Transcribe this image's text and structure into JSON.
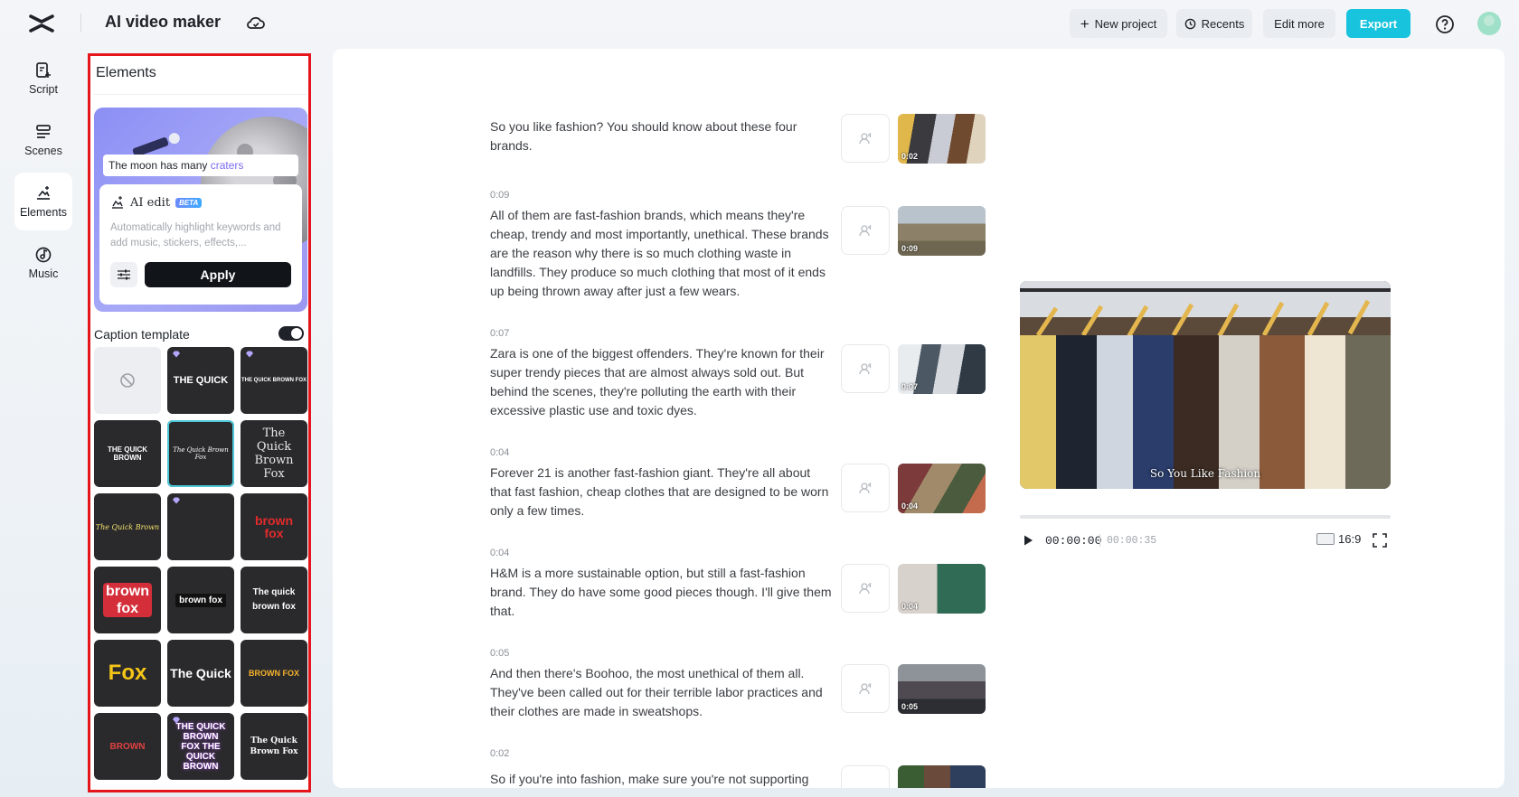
{
  "app": {
    "title": "AI video maker"
  },
  "toolbar": {
    "new_project": "New project",
    "recents": "Recents",
    "edit_more": "Edit more",
    "export": "Export"
  },
  "nav": [
    {
      "label": "Script",
      "icon": "script-icon"
    },
    {
      "label": "Scenes",
      "icon": "scenes-icon"
    },
    {
      "label": "Elements",
      "icon": "elements-icon",
      "active": true
    },
    {
      "label": "Music",
      "icon": "music-icon"
    }
  ],
  "panel": {
    "title": "Elements",
    "ai_card": {
      "caption_prefix": "The moon has many ",
      "caption_highlight": "craters",
      "title": "AI edit",
      "badge": "BETA",
      "description": "Automatically highlight keywords and add music, stickers, effects,...",
      "apply": "Apply"
    },
    "caption_template": {
      "title": "Caption template",
      "enabled": true,
      "templates": [
        {
          "id": "none",
          "text": ""
        },
        {
          "id": "t1",
          "text": "THE QUICK",
          "premium": true
        },
        {
          "id": "t2",
          "text": "THE QUICK BROWN FOX",
          "premium": true
        },
        {
          "id": "t3",
          "text": "THE QUICK BROWN"
        },
        {
          "id": "t4",
          "text": "The Quick Brown Fox",
          "selected": true
        },
        {
          "id": "t5",
          "text": "The Quick Brown Fox"
        },
        {
          "id": "t6",
          "text": "The Quick Brown"
        },
        {
          "id": "t7",
          "text": "",
          "premium": true
        },
        {
          "id": "t8",
          "text": "brown fox"
        },
        {
          "id": "t9",
          "text": "brown fox"
        },
        {
          "id": "t10",
          "text": "brown fox"
        },
        {
          "id": "t11",
          "text": "The quick brown fox"
        },
        {
          "id": "t12",
          "text": "Fox"
        },
        {
          "id": "t13",
          "text": "The Quick"
        },
        {
          "id": "t14",
          "text": "BROWN FOX"
        },
        {
          "id": "t15",
          "text": "BROWN"
        },
        {
          "id": "t16",
          "text": "THE QUICK BROWN FOX THE QUICK BROWN",
          "premium": true
        },
        {
          "id": "t17",
          "text": "The Quick Brown Fox"
        }
      ]
    }
  },
  "scenes": [
    {
      "time": "",
      "text": "So you like fashion? You should know about these four brands.",
      "thumb_time": "0:02"
    },
    {
      "time": "0:09",
      "text": "All of them are fast-fashion brands, which means they're cheap, trendy and most importantly, unethical. These brands are the reason why there is so much clothing waste in landfills. They produce so much clothing that most of it ends up being thrown away after just a few wears.",
      "thumb_time": "0:09"
    },
    {
      "time": "0:07",
      "text": "Zara is one of the biggest offenders. They're known for their super trendy pieces that are almost always sold out. But behind the scenes, they're polluting the earth with their excessive plastic use and toxic dyes.",
      "thumb_time": "0:07"
    },
    {
      "time": "0:04",
      "text": "Forever 21 is another fast-fashion giant. They're all about that fast fashion, cheap clothes that are designed to be worn only a few times.",
      "thumb_time": "0:04"
    },
    {
      "time": "0:04",
      "text": "H&M is a more sustainable option, but still a fast-fashion brand. They do have some good pieces though. I'll give them that.",
      "thumb_time": "0:04"
    },
    {
      "time": "0:05",
      "text": "And then there's Boohoo, the most unethical of them all. They've been called out for their terrible labor practices and their clothes are made in sweatshops.",
      "thumb_time": "0:05"
    },
    {
      "time": "0:02",
      "text": "So if you're into fashion, make sure you're not supporting",
      "thumb_time": ""
    }
  ],
  "preview": {
    "caption": "So You Like Fashion",
    "current_time": "00:00:00",
    "total_time": "00:00:35",
    "aspect_ratio": "16:9",
    "progress": 0
  },
  "colors": {
    "accent": "#17c3dd",
    "highlight_border": "#e4161b",
    "selected_template": "#4ec7d8"
  }
}
